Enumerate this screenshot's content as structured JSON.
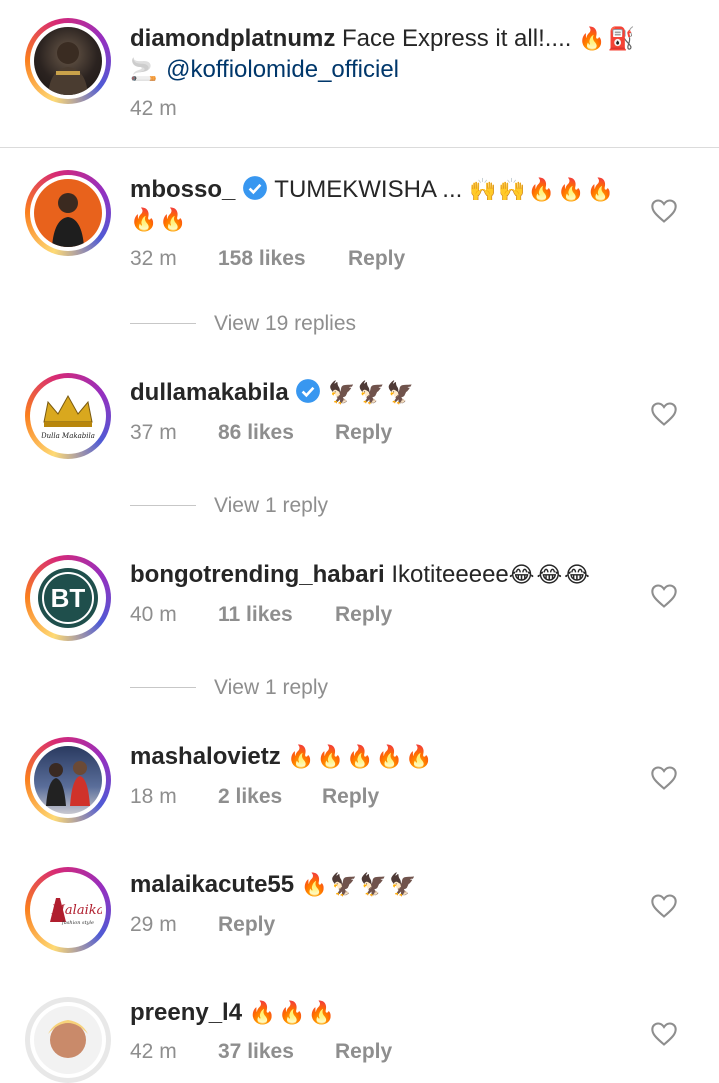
{
  "caption": {
    "username": "diamondplatnumz",
    "text": "Face Express it all!....",
    "emoji_line1": "🔥⛽",
    "emoji_line2": "🚬",
    "mention": "@koffiolomide_officiel",
    "time": "42 m"
  },
  "comments": [
    {
      "username": "mbosso_",
      "verified": true,
      "text": "TUMEKWISHA ...",
      "emoji": "🙌🙌🔥🔥🔥",
      "emoji2": "🔥🔥",
      "time": "32 m",
      "likes": "158 likes",
      "reply": "Reply",
      "view_replies": "View 19 replies"
    },
    {
      "username": "dullamakabila",
      "verified": true,
      "text": "",
      "emoji": "🦅🦅🦅",
      "time": "37 m",
      "likes": "86 likes",
      "reply": "Reply",
      "view_replies": "View 1 reply"
    },
    {
      "username": "bongotrending_habari",
      "verified": false,
      "text": "Ikotiteeeee",
      "emoji": "😂😂😂",
      "time": "40 m",
      "likes": "11 likes",
      "reply": "Reply",
      "view_replies": "View 1 reply"
    },
    {
      "username": "mashalovietz",
      "verified": false,
      "text": "",
      "emoji": "🔥🔥🔥🔥🔥",
      "time": "18 m",
      "likes": "2 likes",
      "reply": "Reply"
    },
    {
      "username": "malaikacute55",
      "verified": false,
      "text": "",
      "emoji": "🔥🦅🦅🦅",
      "time": "29 m",
      "reply": "Reply"
    },
    {
      "username": "preeny_l4",
      "verified": false,
      "text": "",
      "emoji": "🔥🔥🔥",
      "time": "42 m",
      "likes": "37 likes",
      "reply": "Reply"
    }
  ],
  "avatar_labels": {
    "dulla": "Dulla Makabila",
    "bongo": "BT",
    "malaika": "Malaika",
    "malaika_sub": "fashion style"
  },
  "colors": {
    "verified": "#3897f0",
    "mention": "#00376b",
    "meta": "#8e8e8e"
  }
}
